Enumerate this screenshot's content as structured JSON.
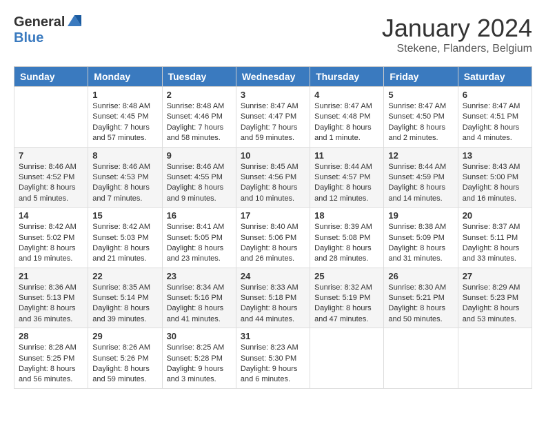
{
  "logo": {
    "general": "General",
    "blue": "Blue"
  },
  "title": "January 2024",
  "location": "Stekene, Flanders, Belgium",
  "days_header": [
    "Sunday",
    "Monday",
    "Tuesday",
    "Wednesday",
    "Thursday",
    "Friday",
    "Saturday"
  ],
  "weeks": [
    [
      {
        "day": "",
        "sunrise": "",
        "sunset": "",
        "daylight": ""
      },
      {
        "day": "1",
        "sunrise": "Sunrise: 8:48 AM",
        "sunset": "Sunset: 4:45 PM",
        "daylight": "Daylight: 7 hours and 57 minutes."
      },
      {
        "day": "2",
        "sunrise": "Sunrise: 8:48 AM",
        "sunset": "Sunset: 4:46 PM",
        "daylight": "Daylight: 7 hours and 58 minutes."
      },
      {
        "day": "3",
        "sunrise": "Sunrise: 8:47 AM",
        "sunset": "Sunset: 4:47 PM",
        "daylight": "Daylight: 7 hours and 59 minutes."
      },
      {
        "day": "4",
        "sunrise": "Sunrise: 8:47 AM",
        "sunset": "Sunset: 4:48 PM",
        "daylight": "Daylight: 8 hours and 1 minute."
      },
      {
        "day": "5",
        "sunrise": "Sunrise: 8:47 AM",
        "sunset": "Sunset: 4:50 PM",
        "daylight": "Daylight: 8 hours and 2 minutes."
      },
      {
        "day": "6",
        "sunrise": "Sunrise: 8:47 AM",
        "sunset": "Sunset: 4:51 PM",
        "daylight": "Daylight: 8 hours and 4 minutes."
      }
    ],
    [
      {
        "day": "7",
        "sunrise": "Sunrise: 8:46 AM",
        "sunset": "Sunset: 4:52 PM",
        "daylight": "Daylight: 8 hours and 5 minutes."
      },
      {
        "day": "8",
        "sunrise": "Sunrise: 8:46 AM",
        "sunset": "Sunset: 4:53 PM",
        "daylight": "Daylight: 8 hours and 7 minutes."
      },
      {
        "day": "9",
        "sunrise": "Sunrise: 8:46 AM",
        "sunset": "Sunset: 4:55 PM",
        "daylight": "Daylight: 8 hours and 9 minutes."
      },
      {
        "day": "10",
        "sunrise": "Sunrise: 8:45 AM",
        "sunset": "Sunset: 4:56 PM",
        "daylight": "Daylight: 8 hours and 10 minutes."
      },
      {
        "day": "11",
        "sunrise": "Sunrise: 8:44 AM",
        "sunset": "Sunset: 4:57 PM",
        "daylight": "Daylight: 8 hours and 12 minutes."
      },
      {
        "day": "12",
        "sunrise": "Sunrise: 8:44 AM",
        "sunset": "Sunset: 4:59 PM",
        "daylight": "Daylight: 8 hours and 14 minutes."
      },
      {
        "day": "13",
        "sunrise": "Sunrise: 8:43 AM",
        "sunset": "Sunset: 5:00 PM",
        "daylight": "Daylight: 8 hours and 16 minutes."
      }
    ],
    [
      {
        "day": "14",
        "sunrise": "Sunrise: 8:42 AM",
        "sunset": "Sunset: 5:02 PM",
        "daylight": "Daylight: 8 hours and 19 minutes."
      },
      {
        "day": "15",
        "sunrise": "Sunrise: 8:42 AM",
        "sunset": "Sunset: 5:03 PM",
        "daylight": "Daylight: 8 hours and 21 minutes."
      },
      {
        "day": "16",
        "sunrise": "Sunrise: 8:41 AM",
        "sunset": "Sunset: 5:05 PM",
        "daylight": "Daylight: 8 hours and 23 minutes."
      },
      {
        "day": "17",
        "sunrise": "Sunrise: 8:40 AM",
        "sunset": "Sunset: 5:06 PM",
        "daylight": "Daylight: 8 hours and 26 minutes."
      },
      {
        "day": "18",
        "sunrise": "Sunrise: 8:39 AM",
        "sunset": "Sunset: 5:08 PM",
        "daylight": "Daylight: 8 hours and 28 minutes."
      },
      {
        "day": "19",
        "sunrise": "Sunrise: 8:38 AM",
        "sunset": "Sunset: 5:09 PM",
        "daylight": "Daylight: 8 hours and 31 minutes."
      },
      {
        "day": "20",
        "sunrise": "Sunrise: 8:37 AM",
        "sunset": "Sunset: 5:11 PM",
        "daylight": "Daylight: 8 hours and 33 minutes."
      }
    ],
    [
      {
        "day": "21",
        "sunrise": "Sunrise: 8:36 AM",
        "sunset": "Sunset: 5:13 PM",
        "daylight": "Daylight: 8 hours and 36 minutes."
      },
      {
        "day": "22",
        "sunrise": "Sunrise: 8:35 AM",
        "sunset": "Sunset: 5:14 PM",
        "daylight": "Daylight: 8 hours and 39 minutes."
      },
      {
        "day": "23",
        "sunrise": "Sunrise: 8:34 AM",
        "sunset": "Sunset: 5:16 PM",
        "daylight": "Daylight: 8 hours and 41 minutes."
      },
      {
        "day": "24",
        "sunrise": "Sunrise: 8:33 AM",
        "sunset": "Sunset: 5:18 PM",
        "daylight": "Daylight: 8 hours and 44 minutes."
      },
      {
        "day": "25",
        "sunrise": "Sunrise: 8:32 AM",
        "sunset": "Sunset: 5:19 PM",
        "daylight": "Daylight: 8 hours and 47 minutes."
      },
      {
        "day": "26",
        "sunrise": "Sunrise: 8:30 AM",
        "sunset": "Sunset: 5:21 PM",
        "daylight": "Daylight: 8 hours and 50 minutes."
      },
      {
        "day": "27",
        "sunrise": "Sunrise: 8:29 AM",
        "sunset": "Sunset: 5:23 PM",
        "daylight": "Daylight: 8 hours and 53 minutes."
      }
    ],
    [
      {
        "day": "28",
        "sunrise": "Sunrise: 8:28 AM",
        "sunset": "Sunset: 5:25 PM",
        "daylight": "Daylight: 8 hours and 56 minutes."
      },
      {
        "day": "29",
        "sunrise": "Sunrise: 8:26 AM",
        "sunset": "Sunset: 5:26 PM",
        "daylight": "Daylight: 8 hours and 59 minutes."
      },
      {
        "day": "30",
        "sunrise": "Sunrise: 8:25 AM",
        "sunset": "Sunset: 5:28 PM",
        "daylight": "Daylight: 9 hours and 3 minutes."
      },
      {
        "day": "31",
        "sunrise": "Sunrise: 8:23 AM",
        "sunset": "Sunset: 5:30 PM",
        "daylight": "Daylight: 9 hours and 6 minutes."
      },
      {
        "day": "",
        "sunrise": "",
        "sunset": "",
        "daylight": ""
      },
      {
        "day": "",
        "sunrise": "",
        "sunset": "",
        "daylight": ""
      },
      {
        "day": "",
        "sunrise": "",
        "sunset": "",
        "daylight": ""
      }
    ]
  ]
}
